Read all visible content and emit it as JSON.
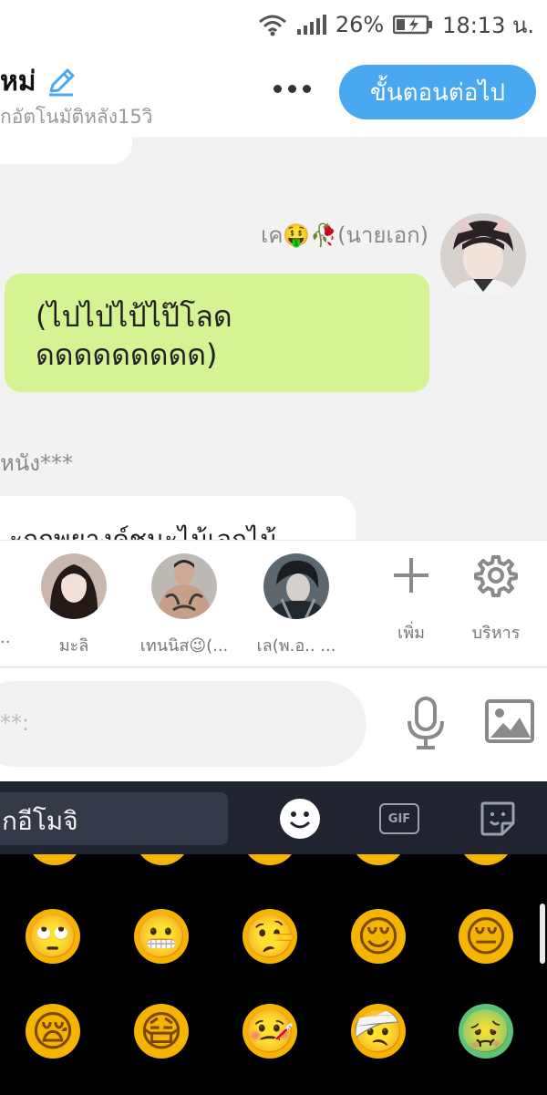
{
  "status_bar": {
    "wifi_icon": "wifi-icon",
    "signal_icon": "signal-bars-icon",
    "battery_percent": "26%",
    "battery_icon": "battery-charging-icon",
    "time": "18:13 น."
  },
  "header": {
    "title": "หม่",
    "edit_icon": "pencil-icon",
    "subtitle": "กอัตโนมัติหลัง15วิ",
    "more_icon": "more-dots-icon",
    "next_button": "ขั้นตอนต่อไป"
  },
  "chat": {
    "sender_name": "เค🤑🥀(นายเอก)",
    "my_message_line1": "(ไปไป่ไป้ไป๊โลด",
    "my_message_line2": "ดดดดดดดดด)",
    "hidden_line": "หนัง***",
    "other_message": "ะถูกพยางค์ชนะไม้เอกไม้"
  },
  "characters": {
    "edge_label": "..",
    "items": [
      {
        "name": "มะลิ"
      },
      {
        "name": "เทนนิส😉(..."
      },
      {
        "name": "เล(พ.อ.. ..."
      }
    ],
    "add_label": "เพิ่ม",
    "manage_label": "บริหาร",
    "add_icon": "plus-icon",
    "manage_icon": "gear-icon"
  },
  "input": {
    "placeholder": "**:",
    "mic_icon": "microphone-icon",
    "image_icon": "image-icon"
  },
  "keyboard": {
    "search_label": "กอีโมจิ",
    "emoji_tab_icon": "smiley-icon",
    "gif_label": "GIF",
    "sticker_icon": "sticker-icon"
  },
  "emojis": {
    "row1": [
      "🙄",
      "😬",
      "🤥",
      "😌",
      "😔"
    ],
    "row2": [
      "😪",
      "😷",
      "🤒",
      "🤕",
      "🤢"
    ],
    "colors": {
      "yellow": "#f4b400",
      "green": "#5ec27a",
      "face": "#7a4a00"
    }
  }
}
